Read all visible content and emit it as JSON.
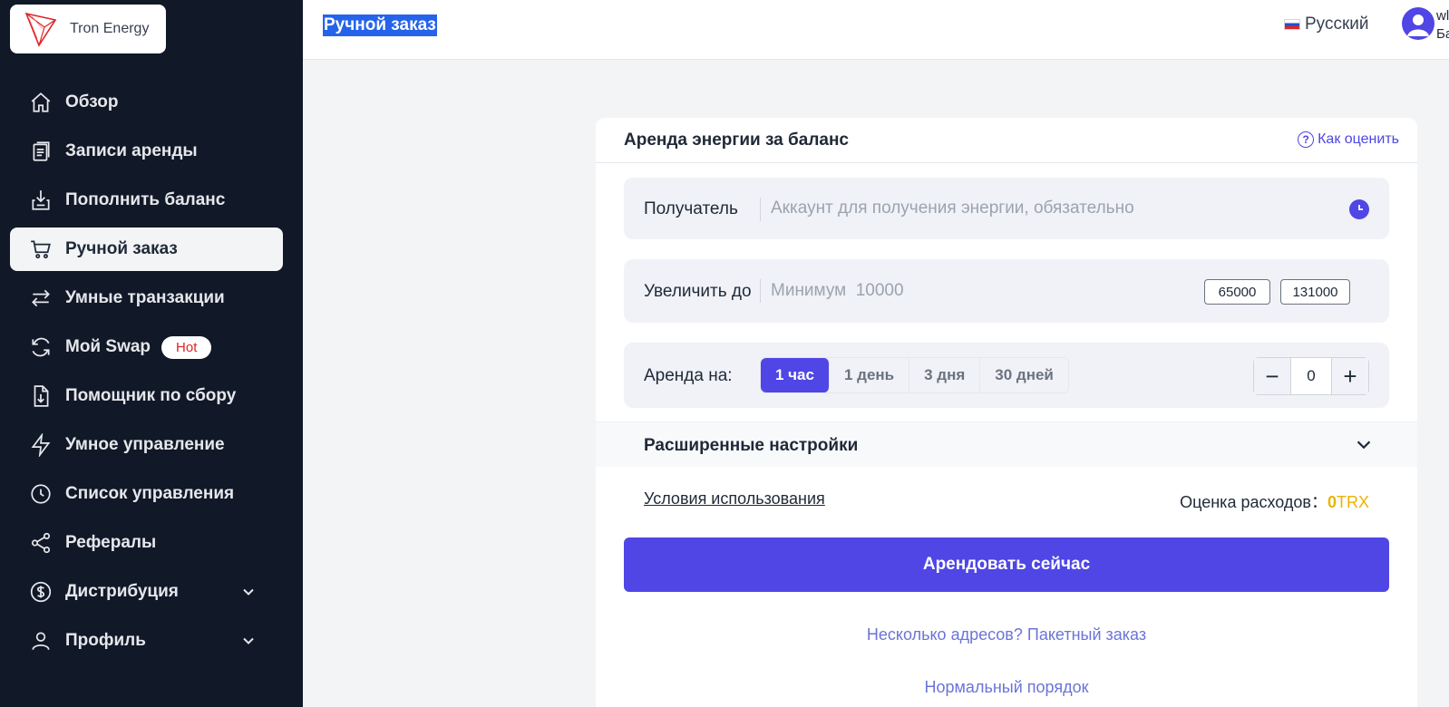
{
  "app": {
    "name": "Tron Energy"
  },
  "header": {
    "title": "Ручной заказ",
    "language": "Русский",
    "user_line1": "wl",
    "user_line2": "Ба"
  },
  "sidebar": {
    "items": [
      {
        "label": "Обзор",
        "icon": "home-icon"
      },
      {
        "label": "Записи аренды",
        "icon": "records-icon"
      },
      {
        "label": "Пополнить баланс",
        "icon": "deposit-icon"
      },
      {
        "label": "Ручной заказ",
        "icon": "cart-icon",
        "active": true
      },
      {
        "label": "Умные транзакции",
        "icon": "swap-arrows-icon"
      },
      {
        "label": "Мой Swap",
        "icon": "refresh-icon",
        "badge": "Hot"
      },
      {
        "label": "Помощник по сбору",
        "icon": "download-doc-icon"
      },
      {
        "label": "Умное управление",
        "icon": "lightning-icon"
      },
      {
        "label": "Список управления",
        "icon": "clock-icon"
      },
      {
        "label": "Рефералы",
        "icon": "share-icon"
      },
      {
        "label": "Дистрибуция",
        "icon": "dollar-icon",
        "expandable": true
      },
      {
        "label": "Профиль",
        "icon": "user-icon",
        "expandable": true
      }
    ]
  },
  "card": {
    "title": "Аренда энергии за баланс",
    "how_link": "Как оценить",
    "recipient": {
      "label": "Получатель",
      "placeholder": "Аккаунт для получения энергии, обязательно"
    },
    "increase": {
      "label": "Увеличить до",
      "placeholder_prefix": "Минимум",
      "placeholder_value": "10000",
      "chips": [
        "65000",
        "131000"
      ]
    },
    "rent_for": {
      "label": "Аренда на:",
      "options": [
        "1 час",
        "1 день",
        "3 дня",
        "30 дней"
      ],
      "selected": "1 час",
      "quantity": "0"
    },
    "advanced": "Расширенные настройки",
    "terms": "Условия использования",
    "cost_label": "Оценка расходов：",
    "cost_value": "0",
    "cost_unit": "TRX",
    "rent_button": "Арендовать сейчас",
    "batch_link": "Несколько адресов? Пакетный заказ",
    "normal_link": "Нормальный порядок"
  },
  "colors": {
    "sidebar_bg": "#111827",
    "accent": "#4f46e5",
    "cost": "#eab308",
    "hot": "#dc2626"
  }
}
